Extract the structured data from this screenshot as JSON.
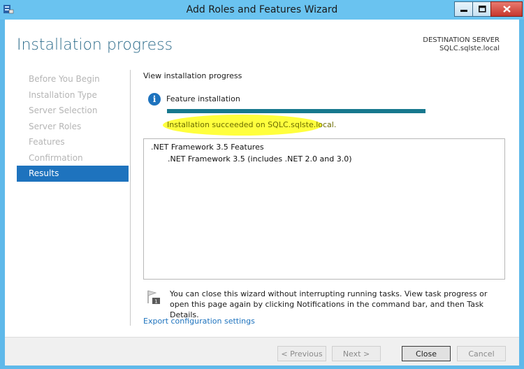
{
  "window": {
    "title": "Add Roles and Features Wizard"
  },
  "header": {
    "page_title": "Installation progress",
    "destination_label": "DESTINATION SERVER",
    "destination_server": "SQLC.sqlste.local"
  },
  "nav": {
    "items": [
      {
        "label": "Before You Begin",
        "active": false
      },
      {
        "label": "Installation Type",
        "active": false
      },
      {
        "label": "Server Selection",
        "active": false
      },
      {
        "label": "Server Roles",
        "active": false
      },
      {
        "label": "Features",
        "active": false
      },
      {
        "label": "Confirmation",
        "active": false
      },
      {
        "label": "Results",
        "active": true
      }
    ]
  },
  "main": {
    "section_heading": "View installation progress",
    "feature_label": "Feature installation",
    "progress_percent": 100,
    "status_message": "Installation succeeded on SQLC.sqlste.local.",
    "results": {
      "parent": ".NET Framework 3.5 Features",
      "child": ".NET Framework 3.5 (includes .NET 2.0 and 3.0)"
    },
    "notice": "You can close this wizard without interrupting running tasks. View task progress or open this page again by clicking Notifications in the command bar, and then Task Details.",
    "export_link": "Export configuration settings"
  },
  "footer": {
    "previous": "< Previous",
    "next": "Next >",
    "close": "Close",
    "cancel": "Cancel"
  },
  "colors": {
    "titlebar": "#6ac3f0",
    "accent": "#1e73be",
    "progress": "#17788e",
    "highlight": "#ffff33"
  },
  "icons": {
    "app": "server-manager-icon",
    "info": "info-icon",
    "notice": "notification-flag-icon"
  }
}
